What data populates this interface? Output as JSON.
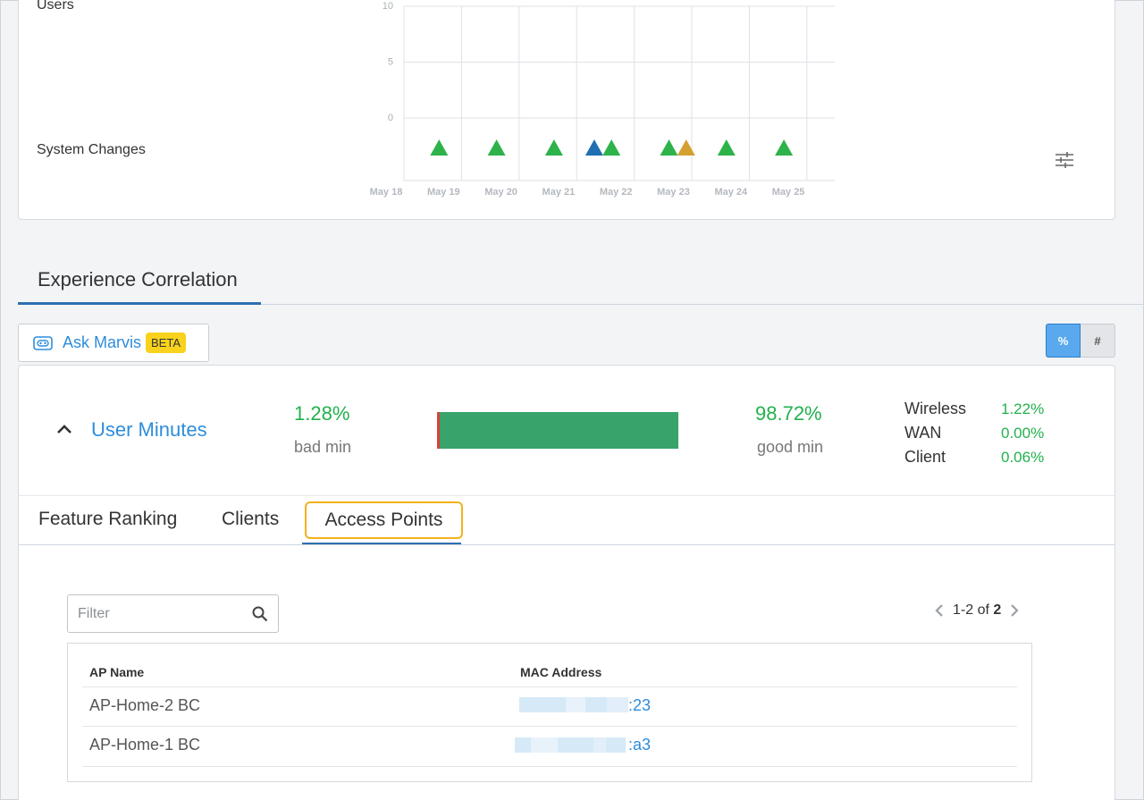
{
  "chart": {
    "users_label": "Users",
    "system_changes_label": "System Changes",
    "y_ticks": [
      "10",
      "5",
      "0"
    ],
    "x_ticks": [
      "May 18",
      "May 19",
      "May 20",
      "May 21",
      "May 22",
      "May 23",
      "May 24",
      "May 25"
    ],
    "events": [
      {
        "day": 19.0,
        "color": "#2db34a"
      },
      {
        "day": 20.0,
        "color": "#2db34a"
      },
      {
        "day": 21.0,
        "color": "#2db34a"
      },
      {
        "day": 21.7,
        "color": "#1f6fb2"
      },
      {
        "day": 22.0,
        "color": "#2db34a"
      },
      {
        "day": 23.0,
        "color": "#2db34a"
      },
      {
        "day": 23.3,
        "color": "#d4a032"
      },
      {
        "day": 24.0,
        "color": "#2db34a"
      },
      {
        "day": 25.0,
        "color": "#2db34a"
      }
    ],
    "filter_icon": "sliders-icon"
  },
  "section": {
    "title": "Experience Correlation"
  },
  "ask_marvis": {
    "icon": "marvis-icon",
    "label": "Ask Marvis",
    "badge": "BETA"
  },
  "toggle": {
    "percent_label": "%",
    "count_label": "#",
    "active": "%"
  },
  "metric": {
    "name": "User Minutes",
    "bad_pct": "1.28%",
    "bad_label": "bad min",
    "good_pct": "98.72%",
    "good_label": "good min",
    "bad_fraction": 0.0128,
    "breakdown": [
      {
        "name": "Wireless",
        "value": "1.22%"
      },
      {
        "name": "WAN",
        "value": "0.00%"
      },
      {
        "name": "Client",
        "value": "0.06%"
      }
    ]
  },
  "tabs": [
    {
      "label": "Feature Ranking"
    },
    {
      "label": "Clients"
    },
    {
      "label": "Access Points",
      "active": true
    }
  ],
  "filter": {
    "placeholder": "Filter",
    "value": ""
  },
  "pagination": {
    "range": "1-2 of",
    "total": "2"
  },
  "table": {
    "headers": [
      "AP Name",
      "MAC Address"
    ],
    "rows": [
      {
        "ap_name": "AP-Home-2 BC",
        "mac_suffix": ":23"
      },
      {
        "ap_name": "AP-Home-1 BC",
        "mac_suffix": ":a3"
      }
    ]
  },
  "colors": {
    "accent": "#2e8ddb",
    "good": "#22b14c",
    "bad": "#d9413a",
    "bar": "#38a36a",
    "highlight": "#f2b21b"
  }
}
